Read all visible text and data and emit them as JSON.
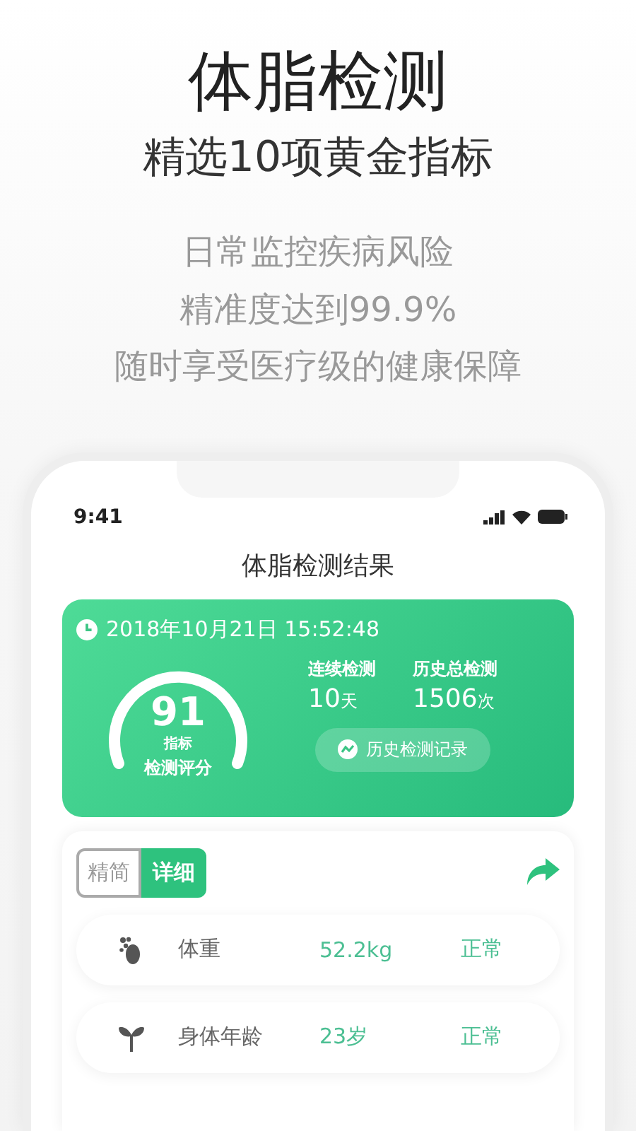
{
  "headline": {
    "title": "体脂检测",
    "subtitle": "精选10项黄金指标"
  },
  "features": [
    "日常监控疾病风险",
    "精准度达到99.9%",
    "随时享受医疗级的健康保障"
  ],
  "status_bar": {
    "time": "9:41"
  },
  "screen_title": "体脂检测结果",
  "summary": {
    "datetime": "2018年10月21日 15:52:48",
    "score": "91",
    "score_unit": "指标",
    "score_label": "检测评分",
    "stats": [
      {
        "label": "连续检测",
        "value": "10",
        "unit": "天"
      },
      {
        "label": "历史总检测",
        "value": "1506",
        "unit": "次"
      }
    ],
    "history_button": "历史检测记录"
  },
  "tabs": [
    {
      "label": "精简",
      "selected": false
    },
    {
      "label": "详细",
      "selected": true
    }
  ],
  "metrics": [
    {
      "kind": "foot",
      "name": "体重",
      "value": "52.2kg",
      "status": "正常"
    },
    {
      "kind": "sprout",
      "name": "身体年龄",
      "value": "23岁",
      "status": "正常"
    }
  ]
}
